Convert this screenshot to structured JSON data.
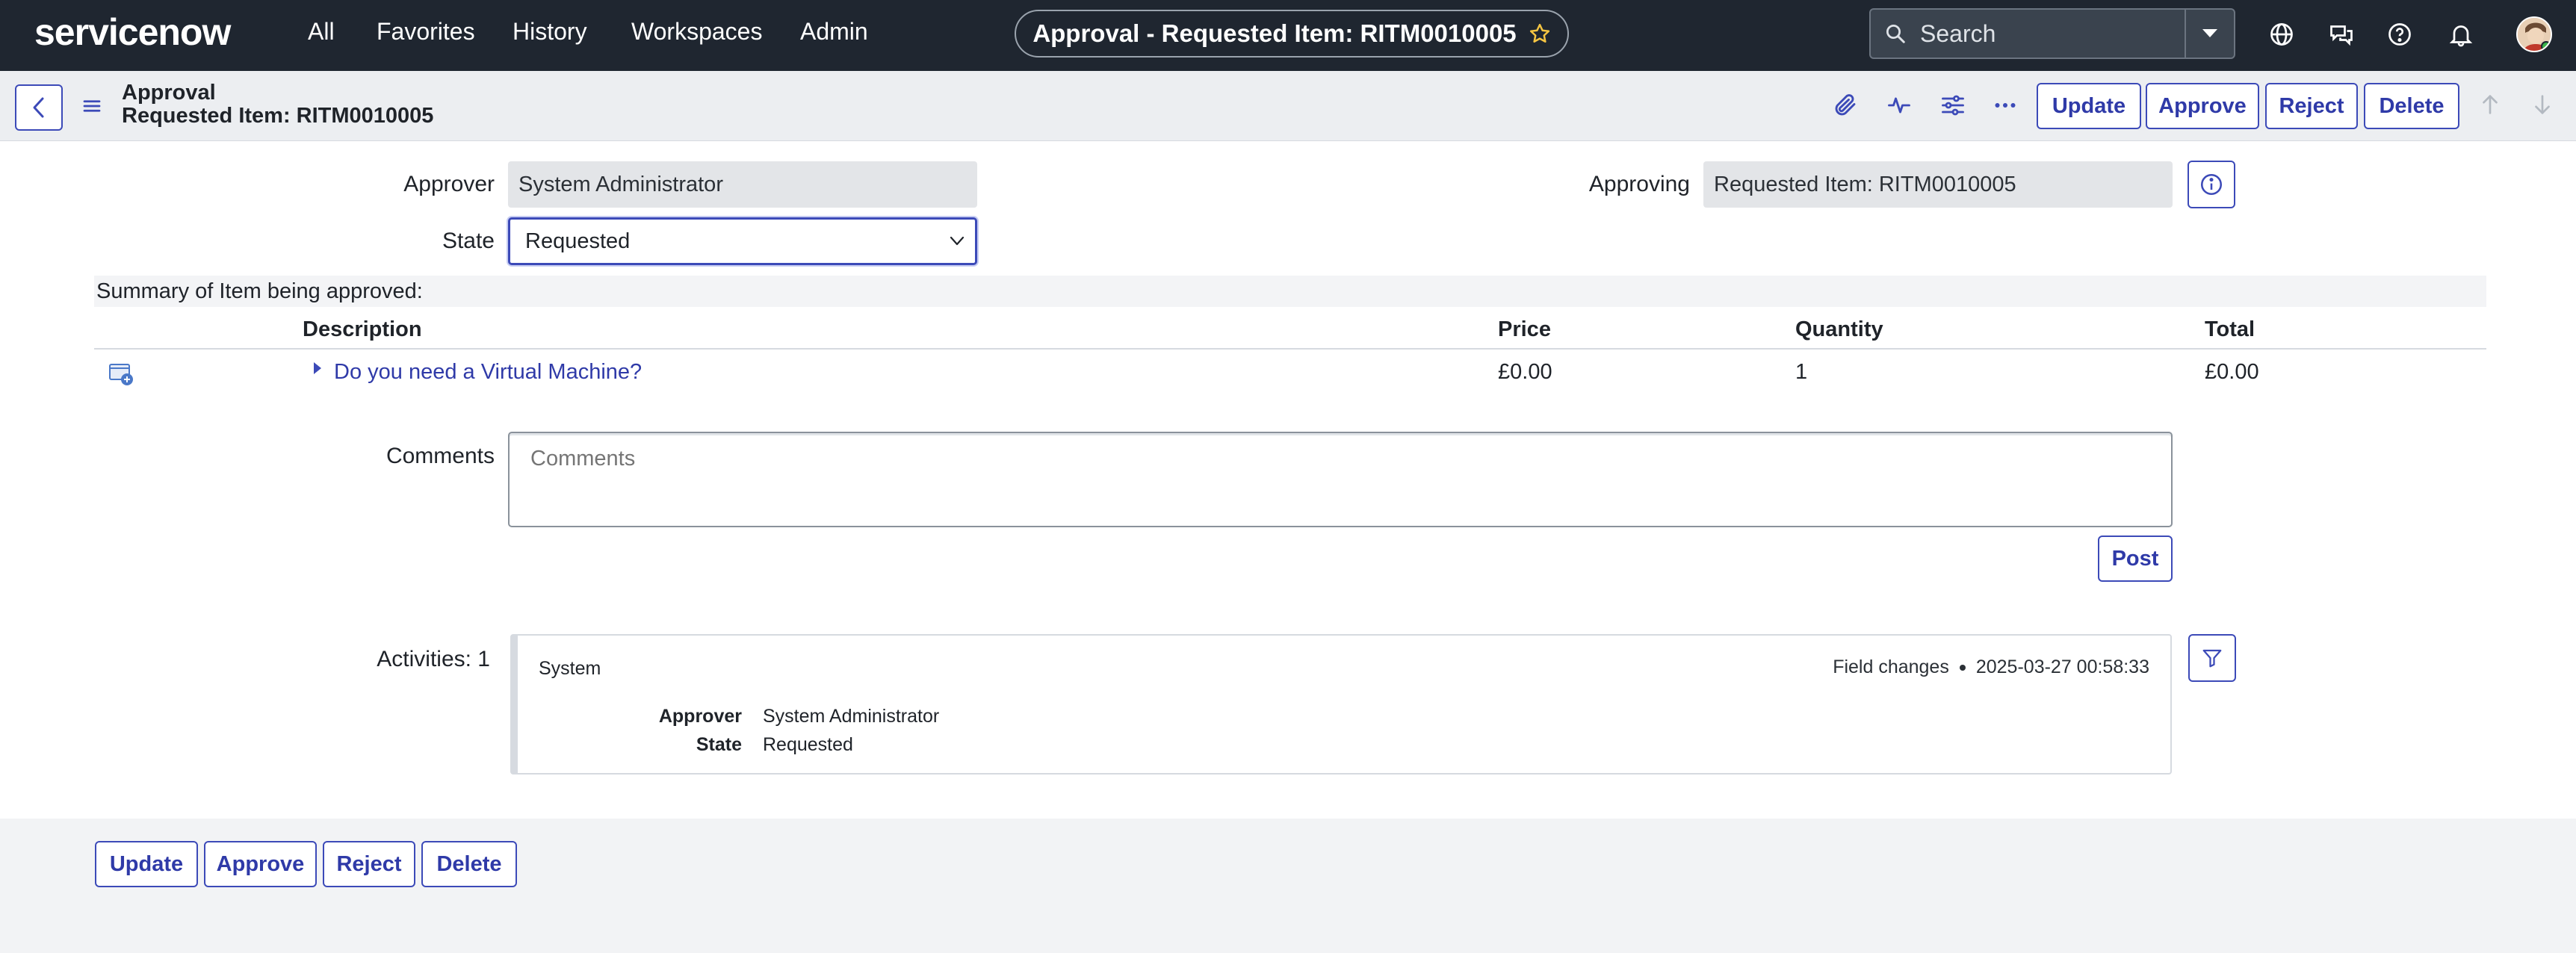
{
  "app": {
    "brand": "servicenow",
    "nav": [
      "All",
      "Favorites",
      "History",
      "Workspaces",
      "Admin"
    ],
    "title_pill": "Approval - Requested Item: RITM0010005",
    "search_placeholder": "Search",
    "icons": [
      "globe-icon",
      "chat-icon",
      "help-icon",
      "bell-icon"
    ]
  },
  "record": {
    "title_line1": "Approval",
    "title_line2": "Requested Item: RITM0010005",
    "header_buttons": [
      "Update",
      "Approve",
      "Reject",
      "Delete"
    ]
  },
  "form": {
    "approver_label": "Approver",
    "approver_value": "System Administrator",
    "approving_label": "Approving",
    "approving_value": "Requested Item: RITM0010005",
    "state_label": "State",
    "state_value": "Requested"
  },
  "summary": {
    "heading": "Summary of Item being approved:",
    "columns": [
      "Description",
      "Price",
      "Quantity",
      "Total"
    ],
    "rows": [
      {
        "description": "Do you need a Virtual Machine?",
        "price": "£0.00",
        "quantity": "1",
        "total": "£0.00"
      }
    ]
  },
  "comments": {
    "label": "Comments",
    "placeholder": "Comments",
    "post_label": "Post"
  },
  "activities": {
    "label": "Activities: 1",
    "entries": [
      {
        "user": "System",
        "type": "Field changes",
        "timestamp": "2025-03-27 00:58:33",
        "changes": [
          {
            "field": "Approver",
            "value": "System Administrator"
          },
          {
            "field": "State",
            "value": "Requested"
          }
        ]
      }
    ]
  },
  "footer": {
    "buttons": [
      "Update",
      "Approve",
      "Reject",
      "Delete"
    ]
  },
  "colors": {
    "nav_bg": "#1f2630",
    "accent": "#3c4ab8",
    "logo_green": "#62d84e"
  }
}
